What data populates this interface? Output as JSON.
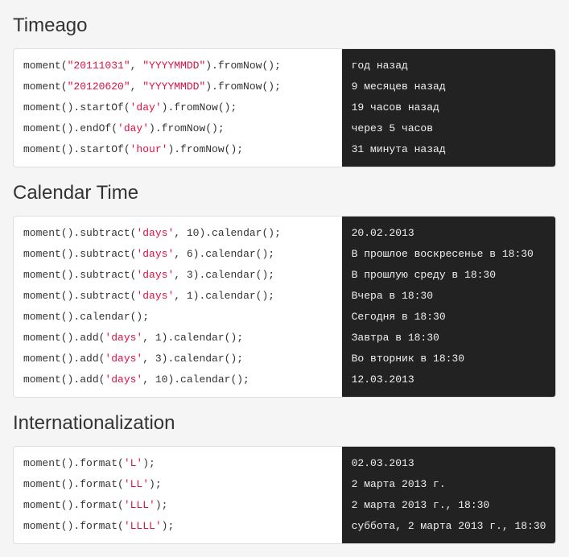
{
  "sections": [
    {
      "title": "Timeago",
      "rows": [
        {
          "code": [
            {
              "t": "moment(",
              "c": "fn"
            },
            {
              "t": "\"20111031\"",
              "c": "str"
            },
            {
              "t": ", ",
              "c": "pn"
            },
            {
              "t": "\"YYYYMMDD\"",
              "c": "str"
            },
            {
              "t": ").fromNow();",
              "c": "fn"
            }
          ],
          "output": "год назад"
        },
        {
          "code": [
            {
              "t": "moment(",
              "c": "fn"
            },
            {
              "t": "\"20120620\"",
              "c": "str"
            },
            {
              "t": ", ",
              "c": "pn"
            },
            {
              "t": "\"YYYYMMDD\"",
              "c": "str"
            },
            {
              "t": ").fromNow();",
              "c": "fn"
            }
          ],
          "output": "9 месяцев назад"
        },
        {
          "code": [
            {
              "t": "moment().startOf(",
              "c": "fn"
            },
            {
              "t": "'day'",
              "c": "kw"
            },
            {
              "t": ").fromNow();",
              "c": "fn"
            }
          ],
          "output": "19 часов назад"
        },
        {
          "code": [
            {
              "t": "moment().endOf(",
              "c": "fn"
            },
            {
              "t": "'day'",
              "c": "kw"
            },
            {
              "t": ").fromNow();",
              "c": "fn"
            }
          ],
          "output": "через 5 часов"
        },
        {
          "code": [
            {
              "t": "moment().startOf(",
              "c": "fn"
            },
            {
              "t": "'hour'",
              "c": "kw"
            },
            {
              "t": ").fromNow();",
              "c": "fn"
            }
          ],
          "output": "31 минута назад"
        }
      ]
    },
    {
      "title": "Calendar Time",
      "rows": [
        {
          "code": [
            {
              "t": "moment().subtract(",
              "c": "fn"
            },
            {
              "t": "'days'",
              "c": "kw"
            },
            {
              "t": ", 10).calendar();",
              "c": "fn"
            }
          ],
          "output": "20.02.2013"
        },
        {
          "code": [
            {
              "t": "moment().subtract(",
              "c": "fn"
            },
            {
              "t": "'days'",
              "c": "kw"
            },
            {
              "t": ", 6).calendar();",
              "c": "fn"
            }
          ],
          "output": "В прошлое воскресенье в 18:30"
        },
        {
          "code": [
            {
              "t": "moment().subtract(",
              "c": "fn"
            },
            {
              "t": "'days'",
              "c": "kw"
            },
            {
              "t": ", 3).calendar();",
              "c": "fn"
            }
          ],
          "output": "В прошлую среду в 18:30"
        },
        {
          "code": [
            {
              "t": "moment().subtract(",
              "c": "fn"
            },
            {
              "t": "'days'",
              "c": "kw"
            },
            {
              "t": ", 1).calendar();",
              "c": "fn"
            }
          ],
          "output": "Вчера в 18:30"
        },
        {
          "code": [
            {
              "t": "moment().calendar();",
              "c": "fn"
            }
          ],
          "output": "Сегодня в 18:30"
        },
        {
          "code": [
            {
              "t": "moment().add(",
              "c": "fn"
            },
            {
              "t": "'days'",
              "c": "kw"
            },
            {
              "t": ", 1).calendar();",
              "c": "fn"
            }
          ],
          "output": "Завтра в 18:30"
        },
        {
          "code": [
            {
              "t": "moment().add(",
              "c": "fn"
            },
            {
              "t": "'days'",
              "c": "kw"
            },
            {
              "t": ", 3).calendar();",
              "c": "fn"
            }
          ],
          "output": "Во вторник в 18:30"
        },
        {
          "code": [
            {
              "t": "moment().add(",
              "c": "fn"
            },
            {
              "t": "'days'",
              "c": "kw"
            },
            {
              "t": ", 10).calendar();",
              "c": "fn"
            }
          ],
          "output": "12.03.2013"
        }
      ]
    },
    {
      "title": "Internationalization",
      "rows": [
        {
          "code": [
            {
              "t": "moment().format(",
              "c": "fn"
            },
            {
              "t": "'L'",
              "c": "kw"
            },
            {
              "t": ");",
              "c": "fn"
            }
          ],
          "output": "02.03.2013"
        },
        {
          "code": [
            {
              "t": "moment().format(",
              "c": "fn"
            },
            {
              "t": "'LL'",
              "c": "kw"
            },
            {
              "t": ");",
              "c": "fn"
            }
          ],
          "output": "2 марта 2013 г."
        },
        {
          "code": [
            {
              "t": "moment().format(",
              "c": "fn"
            },
            {
              "t": "'LLL'",
              "c": "kw"
            },
            {
              "t": ");",
              "c": "fn"
            }
          ],
          "output": "2 марта 2013 г., 18:30"
        },
        {
          "code": [
            {
              "t": "moment().format(",
              "c": "fn"
            },
            {
              "t": "'LLLL'",
              "c": "kw"
            },
            {
              "t": ");",
              "c": "fn"
            }
          ],
          "output": "суббота, 2 марта 2013 г., 18:30"
        }
      ]
    }
  ]
}
